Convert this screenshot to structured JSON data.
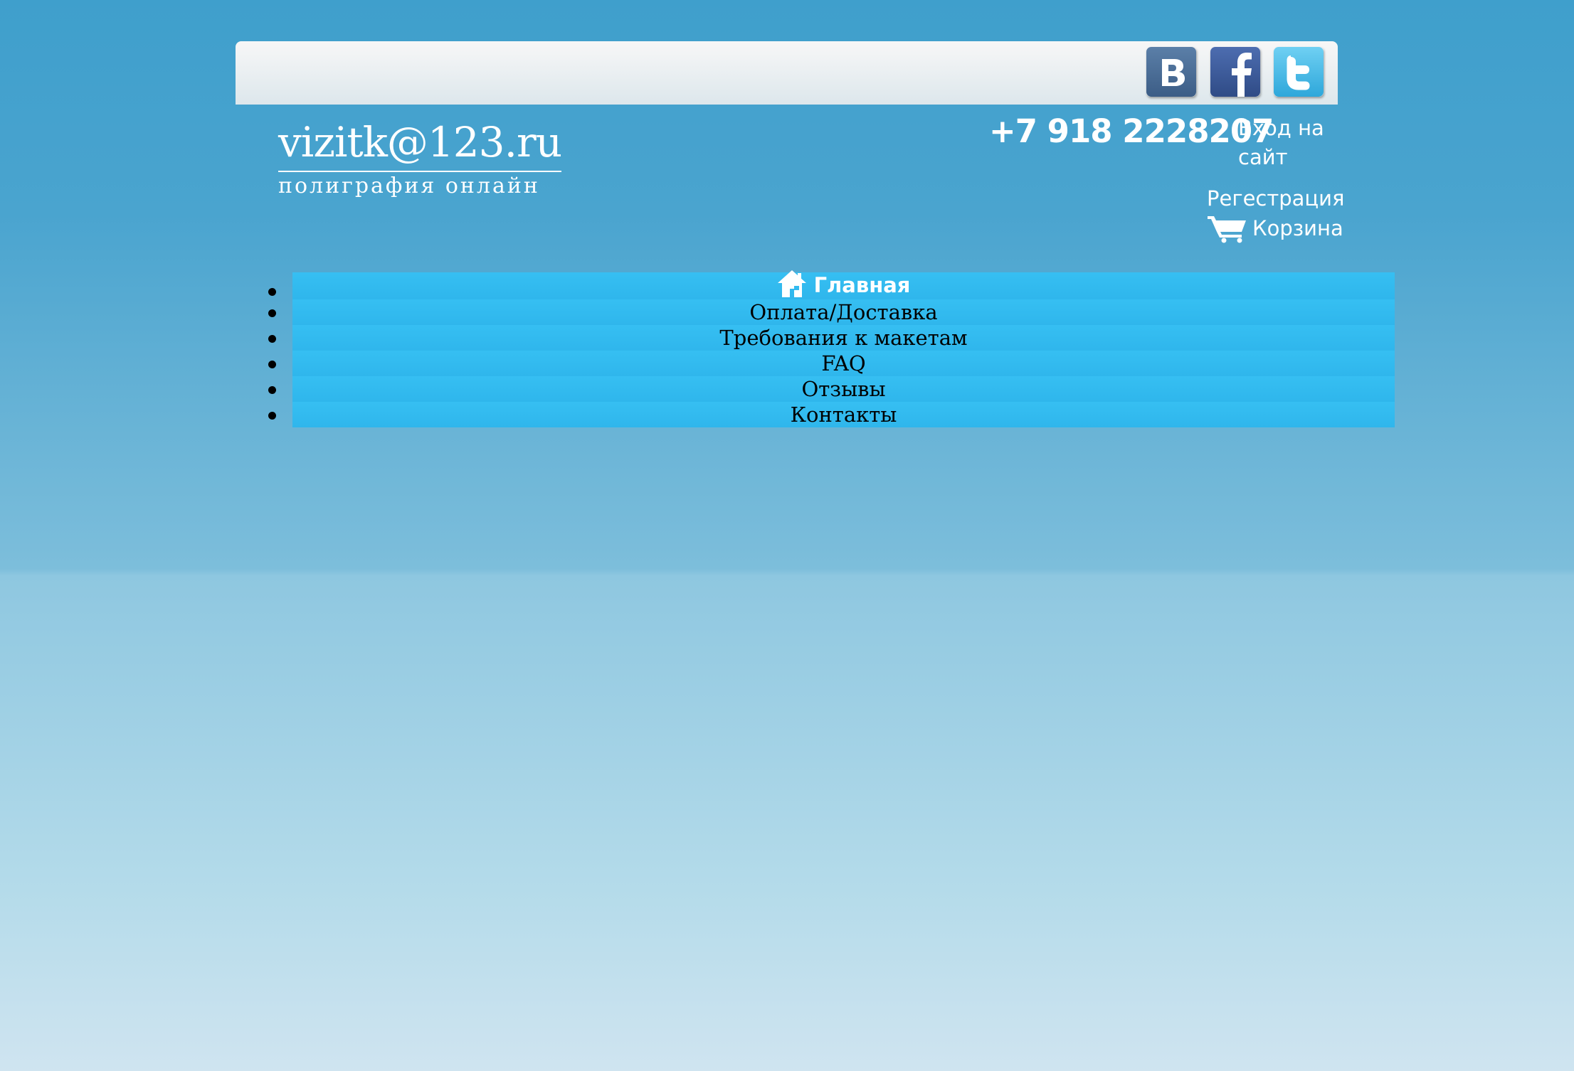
{
  "header": {
    "social": [
      {
        "name": "vkontakte",
        "icon": "vk-icon",
        "color": "#4a6d96"
      },
      {
        "name": "facebook",
        "icon": "facebook-icon",
        "color": "#3b5a9a"
      },
      {
        "name": "twitter",
        "icon": "twitter-icon",
        "color": "#3fb5e6"
      }
    ],
    "logo_title": "vizitk@123.ru",
    "logo_subtitle": "полиграфия онлайн",
    "phone": "+7 918 2228207",
    "login_label": "Вход на сайт",
    "register_label": "Регестрация",
    "cart_label": "Корзина",
    "cart_icon": "shopping-cart-icon"
  },
  "menu": {
    "items": [
      {
        "label": "Главная",
        "icon": "home-icon",
        "active": true
      },
      {
        "label": "Оплата/Доставка"
      },
      {
        "label": "Требования к макетам"
      },
      {
        "label": "FAQ"
      },
      {
        "label": "Отзывы"
      },
      {
        "label": "Контакты"
      }
    ]
  },
  "colors": {
    "background_top": "#3f9fcc",
    "background_bottom": "#cfe4f0",
    "menu_bg": "#33bbf0",
    "text_white": "#ffffff"
  }
}
